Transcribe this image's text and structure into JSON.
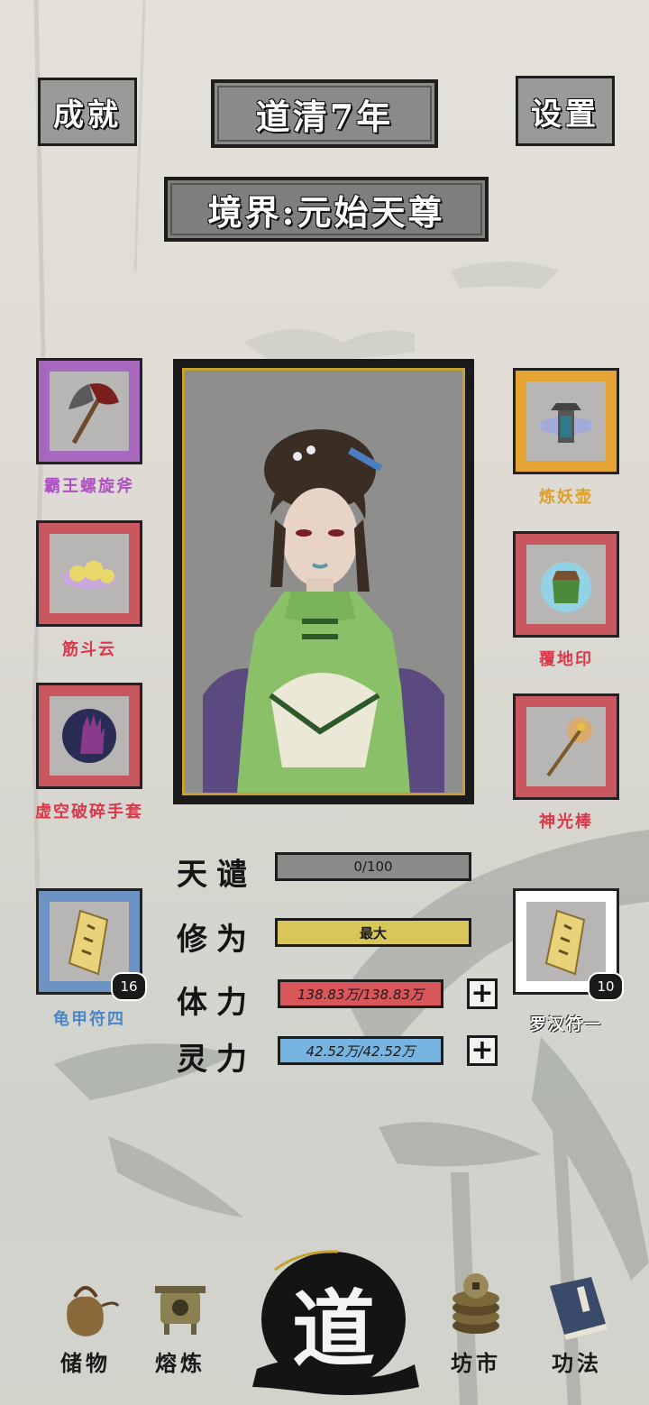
{
  "header": {
    "achievements_label": "成就",
    "year_label": "道清7年",
    "settings_label": "设置",
    "realm_label": "境界:元始天尊"
  },
  "left_slots": [
    {
      "name": "霸王螺旋斧",
      "color": "#b04ec7",
      "border": "#a868c0",
      "icon": "axe-icon"
    },
    {
      "name": "筋斗云",
      "color": "#d8384a",
      "border": "#c9575f",
      "icon": "cloud-icon"
    },
    {
      "name": "虚空破碎手套",
      "color": "#d8384a",
      "border": "#c9575f",
      "icon": "glove-icon"
    }
  ],
  "right_slots": [
    {
      "name": "炼妖壶",
      "color": "#e0a028",
      "border": "#e3a434",
      "icon": "pagoda-icon"
    },
    {
      "name": "覆地印",
      "color": "#d8384a",
      "border": "#c9575f",
      "icon": "seal-icon"
    },
    {
      "name": "神光棒",
      "color": "#d8384a",
      "border": "#c9575f",
      "icon": "staff-icon"
    }
  ],
  "talismans": {
    "left": {
      "name": "龟甲符四",
      "count": "16",
      "color": "#4c86c6",
      "border": "#6d93c4",
      "icon": "talisman-icon"
    },
    "right": {
      "name": "罗汉符一",
      "count": "10",
      "color": "#ffffff",
      "border": "#ffffff",
      "icon": "talisman-icon"
    }
  },
  "stats": {
    "tribulation": {
      "label": "天谴",
      "value": "0/100",
      "progress": 0,
      "color": "#8a8a88"
    },
    "cultivation": {
      "label": "修为",
      "value": "最大",
      "progress": 1,
      "color": "#d8c65a"
    },
    "stamina": {
      "label": "体力",
      "value": "138.83万/138.83万",
      "progress": 1,
      "color": "#d9565a"
    },
    "spirit": {
      "label": "灵力",
      "value": "42.52万/42.52万",
      "progress": 1,
      "color": "#78b4e2"
    }
  },
  "nav": {
    "storage": "储物",
    "smelting": "熔炼",
    "dao": "道",
    "market": "坊市",
    "techniques": "功法"
  }
}
